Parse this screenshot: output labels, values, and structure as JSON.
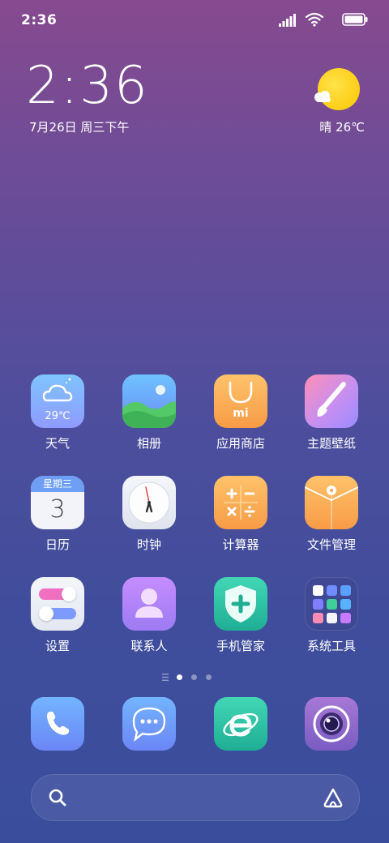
{
  "status_bar": {
    "time": "2:36",
    "icons": [
      "signal-icon",
      "wifi-icon",
      "battery-icon"
    ]
  },
  "clock_widget": {
    "time": "2:36",
    "date": "7月26日 周三下午"
  },
  "weather_widget": {
    "text": "晴 26℃",
    "icon": "sun-cloud-icon"
  },
  "apps": [
    {
      "label": "天气",
      "icon": "weather-icon",
      "icon_text": "29℃"
    },
    {
      "label": "相册",
      "icon": "gallery-icon"
    },
    {
      "label": "应用商店",
      "icon": "app-store-icon",
      "icon_text": "mi"
    },
    {
      "label": "主题壁纸",
      "icon": "themes-icon"
    },
    {
      "label": "日历",
      "icon": "calendar-icon",
      "icon_header": "星期三",
      "icon_day": "3"
    },
    {
      "label": "时钟",
      "icon": "clock-icon"
    },
    {
      "label": "计算器",
      "icon": "calculator-icon"
    },
    {
      "label": "文件管理",
      "icon": "file-manager-icon"
    },
    {
      "label": "设置",
      "icon": "settings-icon"
    },
    {
      "label": "联系人",
      "icon": "contacts-icon"
    },
    {
      "label": "手机管家",
      "icon": "security-icon"
    },
    {
      "label": "系统工具",
      "icon": "system-tools-folder-icon"
    }
  ],
  "page_indicator": {
    "pages": 3,
    "current": 1
  },
  "dock": [
    {
      "icon": "phone-icon"
    },
    {
      "icon": "messages-icon"
    },
    {
      "icon": "browser-icon"
    },
    {
      "icon": "camera-icon"
    }
  ],
  "search_bar": {
    "icons": [
      "search-icon",
      "assistant-icon"
    ]
  },
  "colors": {
    "accent_yellow": "#fbc500",
    "bg_top": "#874a8f",
    "bg_bottom": "#3a4d9d"
  }
}
